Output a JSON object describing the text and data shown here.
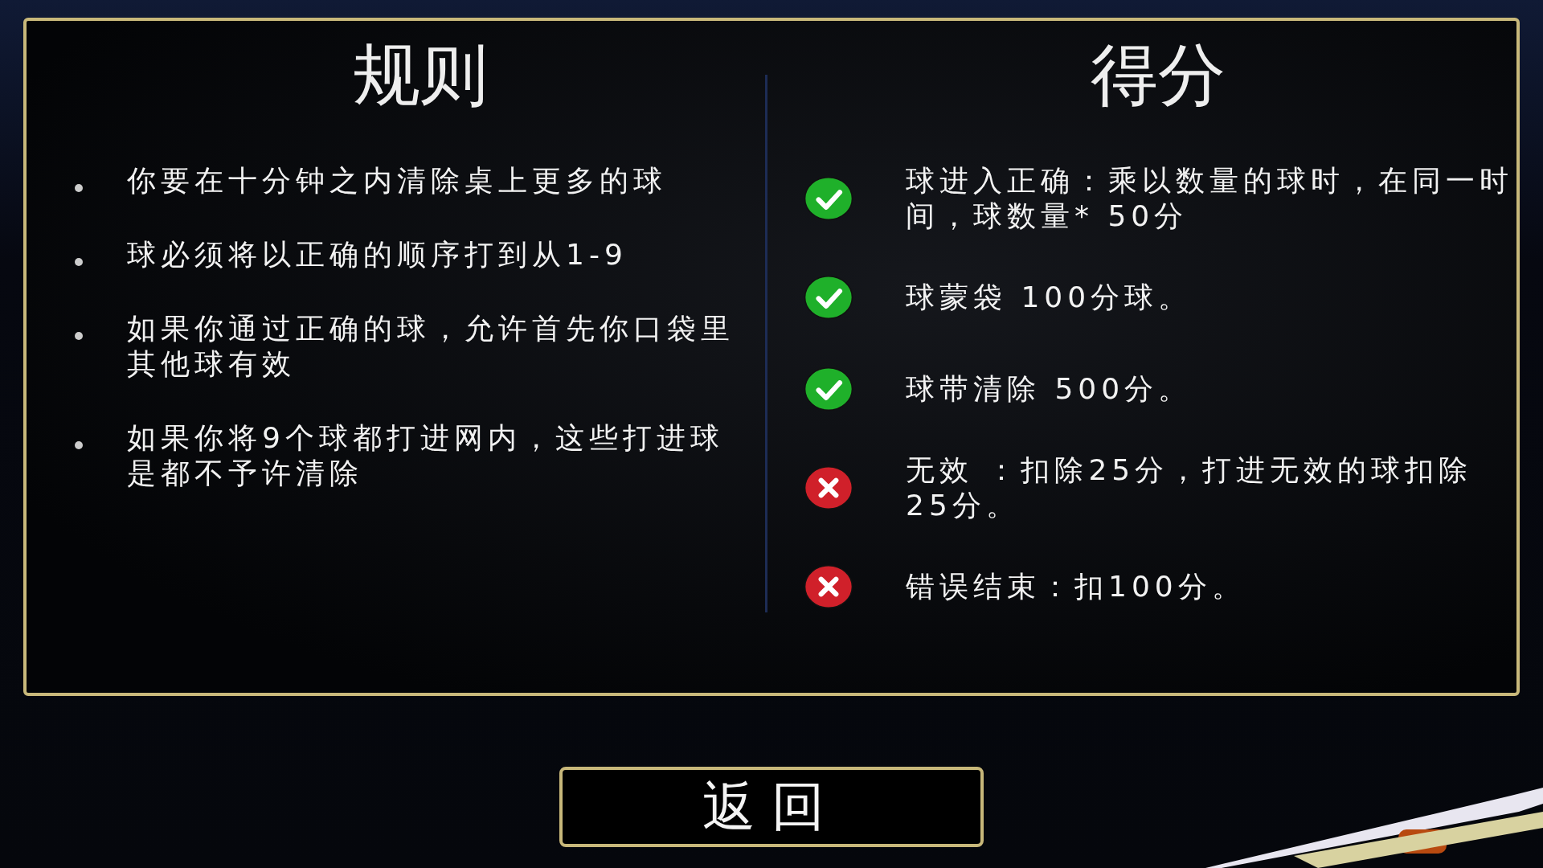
{
  "rules": {
    "title": "规则",
    "items": [
      "你要在十分钟之内清除桌上更多的球",
      "球必须将以正确的顺序打到从1-9",
      "如果你通过正确的球，允许首先你口袋里其他球有效",
      "如果你将9个球都打进网内，这些打进球是都不予许清除"
    ]
  },
  "scoring": {
    "title": "得分",
    "items": [
      {
        "kind": "plus",
        "text": "球进入正确：乘以数量的球时，在同一时间，球数量* 50分"
      },
      {
        "kind": "plus",
        "text": "球蒙袋 100分球。"
      },
      {
        "kind": "plus",
        "text": "球带清除 500分。"
      },
      {
        "kind": "minus",
        "text": "无效 ：扣除25分，打进无效的球扣除25分。"
      },
      {
        "kind": "minus",
        "text": "错误结束：扣100分。"
      }
    ]
  },
  "back_button": "返回"
}
